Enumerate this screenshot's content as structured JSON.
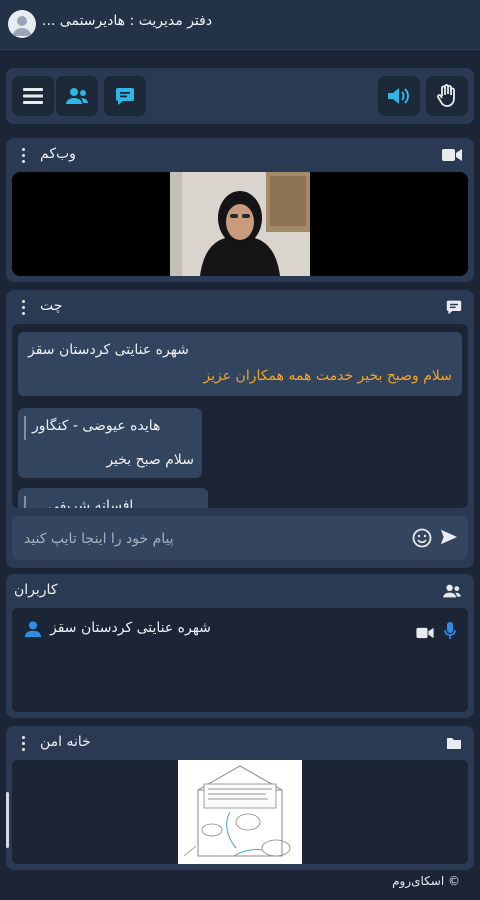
{
  "header": {
    "title": "دفتر مدیریت : هادیرستمی ..."
  },
  "toolbar": {
    "buttons": [
      "menu-icon",
      "users-icon",
      "chat-icon",
      "volume-icon",
      "raise-hand-icon"
    ],
    "accent": "#2fb6e8"
  },
  "webcam": {
    "title": "وب‌کم"
  },
  "chat": {
    "title": "چت",
    "messages": [
      {
        "sender": "شهره عنایتی کردستان سقز",
        "text": "سلام وصبح بخیر خدمت همه همکاران عزیز"
      },
      {
        "sender": "هایده عیوضی - کنگاور",
        "text": "سلام صبح بخیر"
      },
      {
        "sender": "افسانه شریفی",
        "text": ""
      }
    ],
    "input": {
      "placeholder": "پیام خود را اینجا تایپ کنید",
      "value": ""
    },
    "message_highlight_color": "#f5a623"
  },
  "users": {
    "title": "کاربران",
    "list": [
      {
        "name": "شهره عنایتی کردستان سقز"
      }
    ]
  },
  "whiteboard": {
    "title": "خانه امن"
  },
  "footer": {
    "text": "© اسکای‌روم"
  }
}
